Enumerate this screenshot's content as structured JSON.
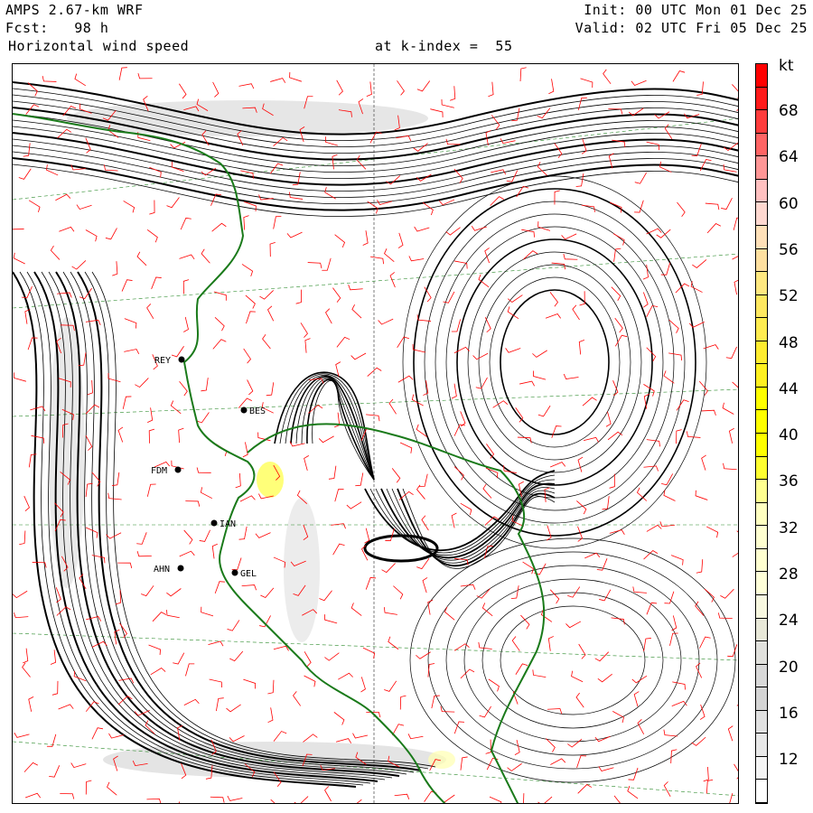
{
  "header": {
    "model": "AMPS 2.67-km WRF",
    "forecast": "Fcst:   98 h",
    "field": "Horizontal wind speed",
    "level": "at k-index =  55",
    "init": "Init: 00 UTC Mon 01 Dec 25",
    "valid": "Valid: 02 UTC Fri 05 Dec 25"
  },
  "colorbar": {
    "unit": "kt",
    "labels": [
      "68",
      "64",
      "60",
      "56",
      "52",
      "48",
      "44",
      "40",
      "36",
      "32",
      "28",
      "24",
      "20",
      "16",
      "12"
    ],
    "colors": [
      "#ff0000",
      "#ff1a1a",
      "#ff3c3c",
      "#ff6464",
      "#ff9696",
      "#ffc0c0",
      "#ffd8d0",
      "#ffe0b8",
      "#ffe0a0",
      "#ffe880",
      "#ffe860",
      "#ffec50",
      "#ffec30",
      "#fff020",
      "#ffff00",
      "#ffff00",
      "#ffff00",
      "#ffff30",
      "#ffff90",
      "#ffffc0",
      "#ffffd0",
      "#ffffd0",
      "#ffffd8",
      "#f8f8e0",
      "#e8e8d8",
      "#e0e0dc",
      "#d8d8d8",
      "#d4d4d4",
      "#e0e0e0",
      "#e8e8e8",
      "#f4f4f4",
      "#ffffff"
    ]
  },
  "map": {
    "coast_color": "#1a7a1a",
    "barb_color": "#ff0000",
    "stations": [
      "REY",
      "BES",
      "FDM",
      "IAN",
      "AHN",
      "GEL"
    ]
  }
}
